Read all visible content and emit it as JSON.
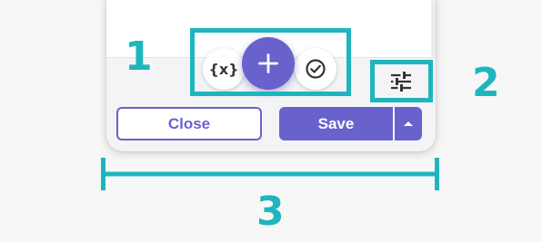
{
  "toolbar": {
    "variable_label": "{x}",
    "add_icon": "plus-icon",
    "check_icon": "check-circle-icon",
    "settings_icon": "sliders-icon"
  },
  "footer": {
    "close_label": "Close",
    "save_label": "Save",
    "save_menu_icon": "caret-up-icon"
  },
  "annotations": {
    "label_1": "1",
    "label_2": "2",
    "label_3": "3"
  },
  "colors": {
    "accent": "#6a62cc",
    "annotation": "#1fb5be",
    "background": "#f7f7f7",
    "panel": "#f4f4f6"
  }
}
